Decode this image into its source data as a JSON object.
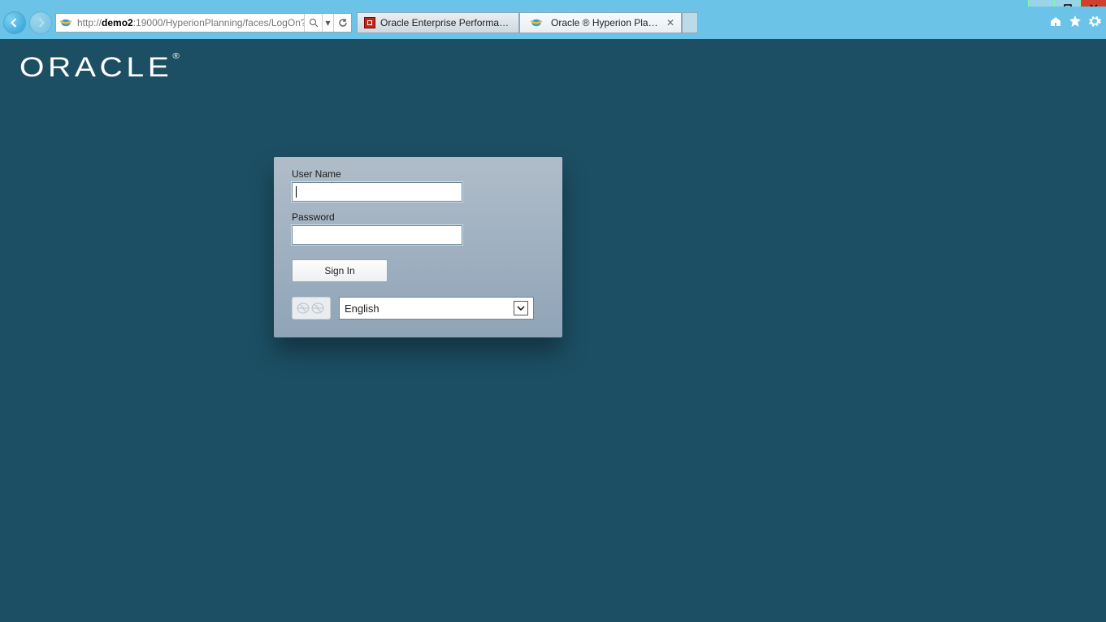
{
  "browser": {
    "address_prefix": "http://",
    "address_host": "demo2",
    "address_rest": ":19000/HyperionPlanning/faces/LogOn?",
    "tabs": [
      {
        "label": "Oracle Enterprise Performance ..."
      },
      {
        "label": "Oracle ® Hyperion Plannin..."
      }
    ],
    "active_tab_index": 1
  },
  "logo_text": "ORACLE",
  "login": {
    "user_label": "User Name",
    "user_value": "",
    "password_label": "Password",
    "password_value": "",
    "signin_label": "Sign In",
    "language_value": "English"
  }
}
